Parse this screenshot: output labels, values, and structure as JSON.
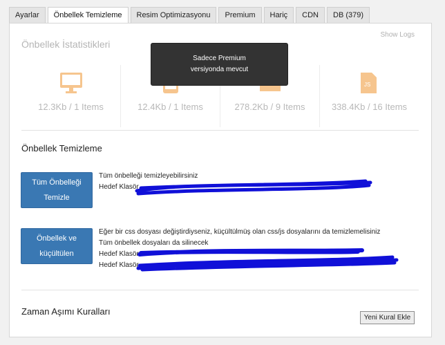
{
  "tabs": [
    {
      "label": "Ayarlar"
    },
    {
      "label": "Önbellek Temizleme"
    },
    {
      "label": "Resim Optimizasyonu"
    },
    {
      "label": "Premium"
    },
    {
      "label": "Hariç"
    },
    {
      "label": "CDN"
    },
    {
      "label": "DB (379)"
    }
  ],
  "show_logs": "Show Logs",
  "stats": {
    "title": "Önbellek İstatistikleri",
    "items": [
      {
        "icon": "monitor-icon",
        "value": "12.3Kb / 1 Items"
      },
      {
        "icon": "tablet-icon",
        "value": "12.4Kb / 1 Items"
      },
      {
        "icon": "folder-icon",
        "value": "278.2Kb / 9 Items"
      },
      {
        "icon": "js-file-icon",
        "value": "338.4Kb / 16 Items"
      }
    ]
  },
  "tooltip": {
    "line1": "Sadece Premium",
    "line2": "versiyonda mevcut"
  },
  "cache_clear": {
    "title": "Önbellek Temizleme",
    "button1": {
      "line1": "Tüm Önbelleği",
      "line2": "Temizle"
    },
    "desc1": {
      "line1": "Tüm önbelleği temizleyebilirsiniz",
      "line2": "Hedef Klasör"
    },
    "button2": {
      "line1": "Önbellek ve",
      "line2": "küçültülen"
    },
    "desc2": {
      "line1": "Eğer bir css dosyası değiştirdiyseniz, küçültülmüş olan css/js dosyalarını da temizlemelisiniz",
      "line2": "Tüm önbellek dosyaları da silinecek",
      "line3": "Hedef Klasör",
      "line4": "Hedef Klasör"
    }
  },
  "timeout": {
    "title": "Zaman Aşımı Kuralları",
    "add_button": "Yeni Kural Ekle"
  },
  "colors": {
    "accent_orange": "#f6c58e",
    "button_blue": "#3a78b3",
    "redaction": "#1010d8"
  }
}
